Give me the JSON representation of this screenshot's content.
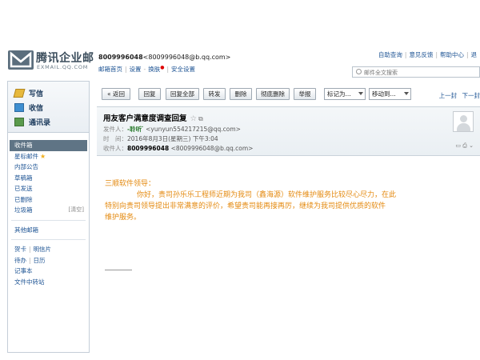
{
  "header": {
    "logo_cn": "腾讯企业邮",
    "logo_en": "EXMAIL.QQ.COM",
    "account_name": "8009996048",
    "account_email": "<8009996048@b.qq.com>",
    "links": [
      "邮箱首页",
      "设置",
      "换肤",
      "安全设置"
    ],
    "top_links": [
      "自助查询",
      "意见反馈",
      "帮助中心",
      "退"
    ],
    "search_placeholder": "邮件全文搜索"
  },
  "sidebar": {
    "actions": [
      "写信",
      "收信",
      "通讯录"
    ],
    "folders": [
      {
        "label": "收件箱",
        "active": true
      },
      {
        "label": "星标邮件"
      },
      {
        "label": "内部公告"
      },
      {
        "label": "草稿箱"
      },
      {
        "label": "已发送"
      },
      {
        "label": "已删除"
      },
      {
        "label": "垃圾箱",
        "extra": "[清空]"
      }
    ],
    "other_folders": "其他邮箱",
    "tools": [
      [
        "贺卡",
        "明信片"
      ],
      [
        "待办",
        "日历"
      ],
      [
        "记事本"
      ],
      [
        "文件中转站"
      ]
    ]
  },
  "toolbar": {
    "back": "« 返回",
    "buttons": [
      "回复",
      "回复全部",
      "转发",
      "删除",
      "彻底删除",
      "举报"
    ],
    "mark_as": "标记为...",
    "move_to": "移动到...",
    "prev": "上一封",
    "next": "下一封"
  },
  "message": {
    "subject": "用友客户满意度调查回复",
    "sender_label": "发件人：",
    "sender_name": "-聆听 ̄",
    "sender_email": "<yunyun554217215@qq.com>",
    "time_label": "时　间：",
    "time": "2016年8月3日(星期三) 下午3:04",
    "recipient_label": "收件人：",
    "recipient_name": "8009996048",
    "recipient_email": "<8009996048@b.qq.com>",
    "greeting": "三顺软件领导：",
    "body_line1": "你好，贵司孙乐乐工程师近期为我司（鑫海源）软件维护服务比较尽心尽力，在此",
    "body_line2": "特别向贵司领导提出非常满意的评价，希望贵司能再接再厉，继续为我司提供优质的软件",
    "body_line3": "维护服务。"
  }
}
